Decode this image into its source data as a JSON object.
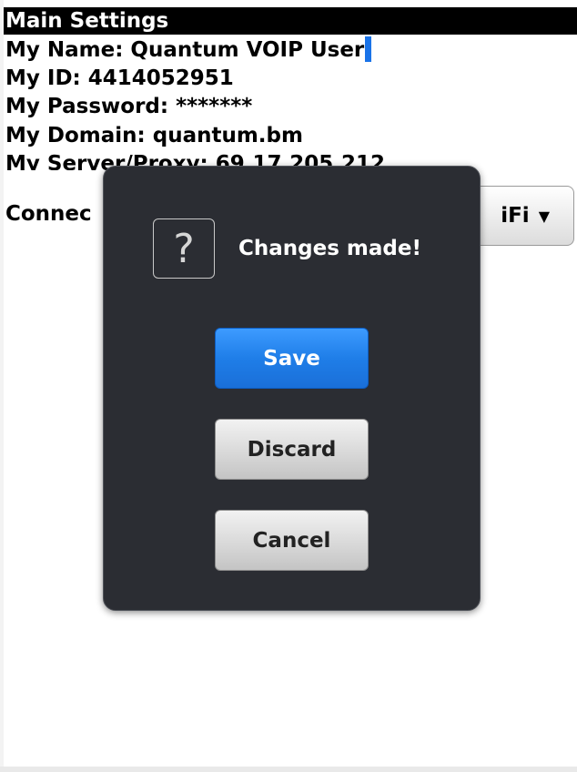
{
  "screen": {
    "title": "Main Settings",
    "fields": {
      "name": "My Name: Quantum VOIP User",
      "id": "My ID: 4414052951",
      "password": "My Password: *******",
      "domain": "My Domain: quantum.bm",
      "server": "My Server/Proxy: 69.17.205.212",
      "connection_label": "Connec"
    },
    "connection_dropdown": {
      "visible_value": "iFi",
      "icon": "triangle-down-icon"
    }
  },
  "dialog": {
    "icon": "question-icon",
    "icon_glyph": "?",
    "message": "Changes made!",
    "buttons": {
      "save": "Save",
      "discard": "Discard",
      "cancel": "Cancel"
    }
  },
  "colors": {
    "title_bg": "#000000",
    "dialog_bg": "#2b2d33",
    "save_button": "#1f7ee8",
    "cursor": "#1a73e8"
  }
}
